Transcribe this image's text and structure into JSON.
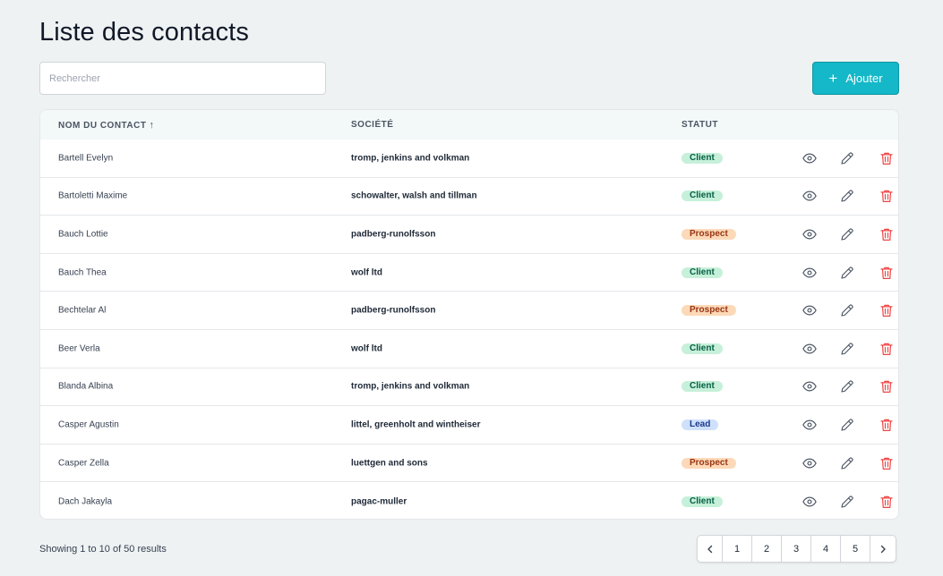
{
  "page_title": "Liste des contacts",
  "search": {
    "placeholder": "Rechercher",
    "value": ""
  },
  "add_button": {
    "icon": "plus-icon",
    "label": "Ajouter"
  },
  "table": {
    "columns": {
      "name": "NOM DU CONTACT",
      "name_sort": "↑",
      "company": "SOCIÉTÉ",
      "status": "STATUT"
    },
    "rows": [
      {
        "name": "Bartell Evelyn",
        "company": "tromp, jenkins and volkman",
        "status": "Client"
      },
      {
        "name": "Bartoletti Maxime",
        "company": "schowalter, walsh and tillman",
        "status": "Client"
      },
      {
        "name": "Bauch Lottie",
        "company": "padberg-runolfsson",
        "status": "Prospect"
      },
      {
        "name": "Bauch Thea",
        "company": "wolf ltd",
        "status": "Client"
      },
      {
        "name": "Bechtelar Al",
        "company": "padberg-runolfsson",
        "status": "Prospect"
      },
      {
        "name": "Beer Verla",
        "company": "wolf ltd",
        "status": "Client"
      },
      {
        "name": "Blanda Albina",
        "company": "tromp, jenkins and volkman",
        "status": "Client"
      },
      {
        "name": "Casper Agustin",
        "company": "littel, greenholt and wintheiser",
        "status": "Lead"
      },
      {
        "name": "Casper Zella",
        "company": "luettgen and sons",
        "status": "Prospect"
      },
      {
        "name": "Dach Jakayla",
        "company": "pagac-muller",
        "status": "Client"
      }
    ],
    "row_actions": [
      "eye-icon",
      "pencil-icon",
      "trash-icon"
    ]
  },
  "footer": {
    "summary": "Showing 1 to 10 of 50 results",
    "pagination": {
      "prev_icon": "chevron-left-icon",
      "pages": [
        "1",
        "2",
        "3",
        "4",
        "5"
      ],
      "next_icon": "chevron-right-icon"
    }
  },
  "colors": {
    "accent": "#14b8c8",
    "delete": "#ef4444",
    "client_badge": "#c6f0d9",
    "prospect_badge": "#fcd9b8",
    "lead_badge": "#cfe0fb"
  }
}
